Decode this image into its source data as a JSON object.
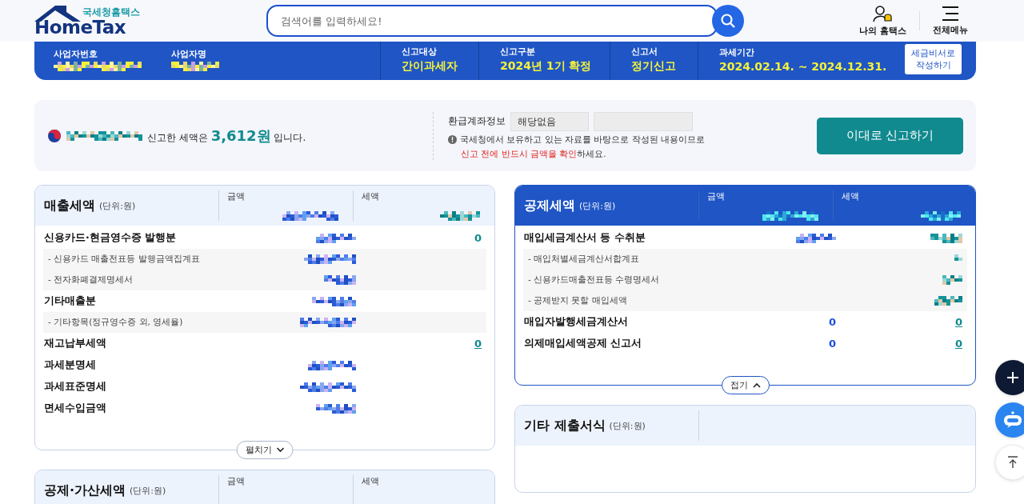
{
  "header": {
    "logo_small": "국세청홈택스",
    "logo": "HomeTax",
    "search": {
      "placeholder": "검색어를 입력하세요!"
    },
    "nav": [
      {
        "label": "나의 홈택스",
        "kind": "user"
      },
      {
        "label": "전체메뉴",
        "kind": "menu"
      }
    ]
  },
  "banner": {
    "fields": [
      {
        "label": "사업자번호",
        "kind": "masked"
      },
      {
        "label": "사업자명",
        "kind": "masked"
      },
      {
        "label": "신고대상",
        "kind": "text",
        "value": "간이과세자"
      },
      {
        "label": "신고구분",
        "kind": "text",
        "value": "2024년 1기 확정"
      },
      {
        "label": "신고서",
        "kind": "text",
        "value": "정기신고"
      },
      {
        "label": "과세기간",
        "kind": "text",
        "value": "2024.02.14. ~ 2024.12.31."
      }
    ],
    "button": [
      "세금비서로",
      "작성하기"
    ]
  },
  "summary": {
    "prefix": "신고한 세액은",
    "amount": "3,612원",
    "suffix": "입니다.",
    "account_label": "환급계좌정보",
    "account_value": "해당없음",
    "notice": "국세청에서 보유하고 있는 자료를 바탕으로 작성된 내용이므로",
    "warning": "신고 전에 반드시 금액을 확인",
    "warning_suffix": "하세요.",
    "submit": "이대로 신고하기"
  },
  "left_panels": [
    {
      "title": "매출세액",
      "unit": "(단위:원)",
      "expanded": false,
      "toggle": "펼치기",
      "columns": [
        "금액",
        "세액"
      ],
      "rows": [
        {
          "kind": "main",
          "label": "신용카드·현금영수증 발행분",
          "amount": {
            "kind": "masked"
          },
          "tax": {
            "kind": "text",
            "value": "0",
            "link": false
          }
        },
        {
          "kind": "sub",
          "label": "- 신용카드 매출전표등 발행금액집계표",
          "amount": {
            "kind": "masked"
          }
        },
        {
          "kind": "sub",
          "label": "- 전자화폐결제명세서",
          "amount": {
            "kind": "masked"
          }
        },
        {
          "kind": "main",
          "label": "기타매출분",
          "amount": {
            "kind": "masked"
          }
        },
        {
          "kind": "sub",
          "label": "- 기타항목(정규영수증 외, 영세율)",
          "amount": {
            "kind": "masked"
          }
        },
        {
          "kind": "main",
          "label": "재고납부세액",
          "tax": {
            "kind": "text",
            "value": "0",
            "link": true
          }
        },
        {
          "kind": "main",
          "label": "과세분명세",
          "amount": {
            "kind": "masked"
          }
        },
        {
          "kind": "main",
          "label": "과세표준명세",
          "amount": {
            "kind": "masked"
          }
        },
        {
          "kind": "main",
          "label": "면세수입금액",
          "amount": {
            "kind": "masked"
          }
        }
      ]
    },
    {
      "title": "공제·가산세액",
      "unit": "(단위:원)",
      "expanded": false,
      "columns": [
        "금액",
        "세액"
      ]
    }
  ],
  "right_panels": [
    {
      "title": "공제세액",
      "unit": "(단위:원)",
      "expanded": true,
      "toggle": "접기",
      "columns": [
        "금액",
        "세액"
      ],
      "rows": [
        {
          "kind": "main",
          "label": "매입세금계산서 등 수취분",
          "amount": {
            "kind": "masked"
          },
          "tax": {
            "kind": "masked"
          }
        },
        {
          "kind": "sub",
          "label": "- 매입처별세금계산서합계표",
          "tax": {
            "kind": "masked"
          }
        },
        {
          "kind": "sub",
          "label": "- 신용카드매출전표등 수령명세서",
          "tax": {
            "kind": "masked"
          }
        },
        {
          "kind": "sub",
          "label": "- 공제받지 못할 매입세액",
          "tax": {
            "kind": "masked"
          }
        },
        {
          "kind": "main",
          "label": "매입자발행세금계산서",
          "amount": {
            "kind": "text",
            "value": "0",
            "link": false
          },
          "tax": {
            "kind": "text",
            "value": "0",
            "link": true
          }
        },
        {
          "kind": "main",
          "label": "의제매입세액공제 신고서",
          "amount": {
            "kind": "text",
            "value": "0",
            "link": false
          },
          "tax": {
            "kind": "text",
            "value": "0",
            "link": true
          }
        }
      ]
    },
    {
      "title": "기타 제출서식",
      "unit": "(단위:원)",
      "expanded": false
    }
  ]
}
